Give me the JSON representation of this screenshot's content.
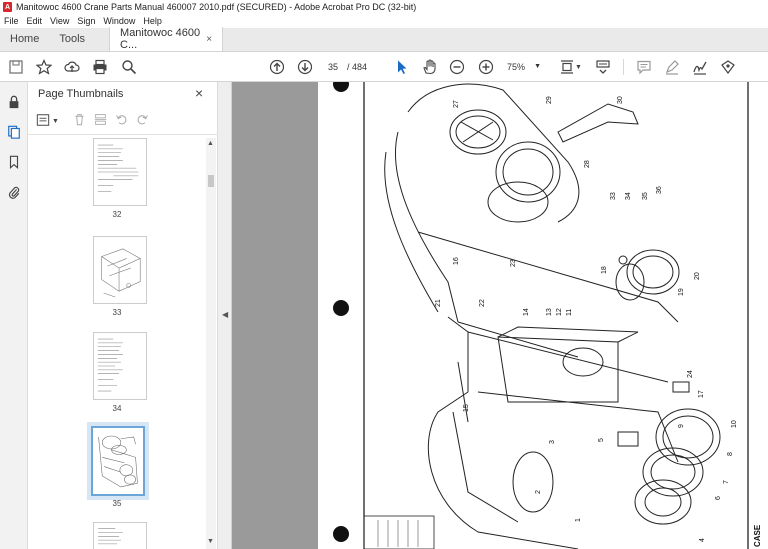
{
  "window": {
    "title": "Manitowoc 4600 Crane Parts Manual 460007 2010.pdf (SECURED) - Adobe Acrobat Pro DC (32-bit)",
    "app_icon_letter": "A"
  },
  "menu": [
    "File",
    "Edit",
    "View",
    "Sign",
    "Window",
    "Help"
  ],
  "tabs": {
    "home": "Home",
    "tools": "Tools",
    "document": "Manitowoc 4600 C...",
    "close": "×"
  },
  "toolbar": {
    "page_current": "35",
    "page_total": "/ 484",
    "zoom": "75%",
    "icons": [
      "save-icon",
      "bookmark-star-icon",
      "upload-icon",
      "print-icon",
      "search-icon",
      "page-up-icon",
      "page-down-icon",
      "select-cursor-icon",
      "hand-tool-icon",
      "zoom-out-icon",
      "zoom-in-icon",
      "fit-page-icon",
      "scroll-mode-icon",
      "comment-icon",
      "highlight-icon",
      "sign-icon",
      "fill-sign-icon"
    ]
  },
  "panel": {
    "title": "Page Thumbnails",
    "close": "×",
    "thumbnails": [
      {
        "label": "32",
        "selected": false
      },
      {
        "label": "33",
        "selected": false
      },
      {
        "label": "34",
        "selected": false
      },
      {
        "label": "35",
        "selected": true
      },
      {
        "label": "",
        "selected": false
      }
    ]
  },
  "document": {
    "part_numbers": [
      "27",
      "29",
      "30",
      "28",
      "33",
      "34",
      "35",
      "36",
      "23",
      "18",
      "20",
      "19",
      "21",
      "22",
      "14",
      "13",
      "12",
      "11",
      "16",
      "24",
      "15",
      "17",
      "2",
      "3",
      "5",
      "6",
      "7",
      "8",
      "9",
      "10",
      "4",
      "1"
    ],
    "side_text": "CASE"
  }
}
